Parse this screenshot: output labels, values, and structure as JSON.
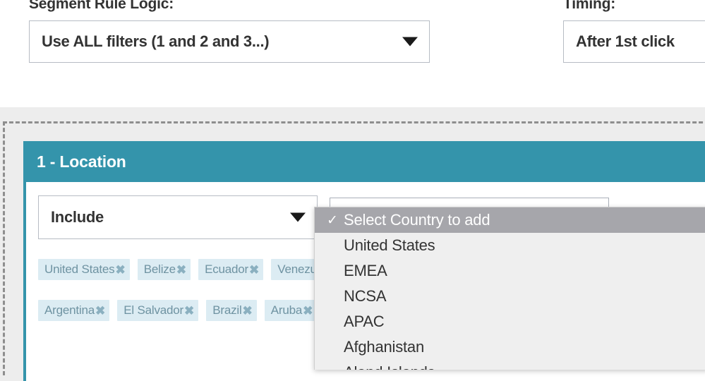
{
  "top_panel": {
    "segment_rule_logic": {
      "label": "Segment Rule Logic:",
      "selected": "Use ALL filters (1 and 2 and 3...)",
      "caret_icon": "chevron-down-icon"
    },
    "timing": {
      "label": "Timing:",
      "selected": "After 1st click",
      "caret_icon": "chevron-down-icon"
    }
  },
  "rule_card": {
    "header_title": "1 - Location",
    "accent_color": "#3494ab",
    "include_select": {
      "selected": "Include",
      "caret_icon": "chevron-down-icon"
    },
    "country_search": {
      "value": "",
      "placeholder": ""
    },
    "tag_rows": [
      [
        {
          "label": "United States",
          "remove_icon": "close-icon"
        },
        {
          "label": "Belize",
          "remove_icon": "close-icon"
        },
        {
          "label": "Ecuador",
          "remove_icon": "close-icon"
        },
        {
          "label": "Venezuela",
          "remove_icon": "close-icon"
        }
      ],
      [
        {
          "label": "Argentina",
          "remove_icon": "close-icon"
        },
        {
          "label": "El Salvador",
          "remove_icon": "close-icon"
        },
        {
          "label": "Brazil",
          "remove_icon": "close-icon"
        },
        {
          "label": "Aruba",
          "remove_icon": "close-icon"
        }
      ]
    ]
  },
  "country_dropdown": {
    "check_glyph": "✓",
    "items": [
      {
        "label": "Select Country to add",
        "selected": true
      },
      {
        "label": "United States",
        "selected": false
      },
      {
        "label": "EMEA",
        "selected": false
      },
      {
        "label": "NCSA",
        "selected": false
      },
      {
        "label": "APAC",
        "selected": false
      },
      {
        "label": "Afghanistan",
        "selected": false
      },
      {
        "label": "Aland Islands",
        "selected": false
      }
    ]
  }
}
